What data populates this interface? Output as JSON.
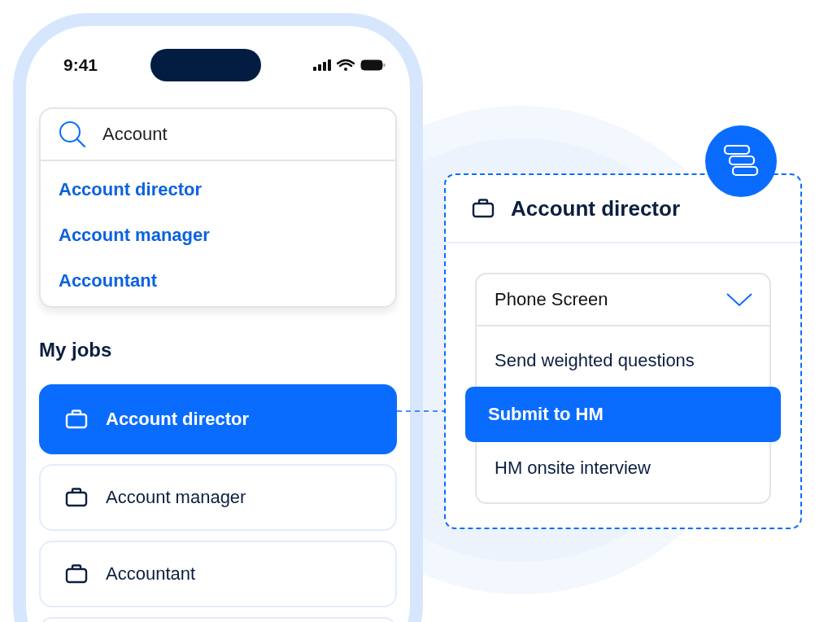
{
  "status_bar": {
    "time": "9:41"
  },
  "search": {
    "value": "Account"
  },
  "suggestions": [
    {
      "label": "Account director"
    },
    {
      "label": "Account manager"
    },
    {
      "label": "Accountant"
    }
  ],
  "my_jobs": {
    "title": "My jobs",
    "items": [
      {
        "label": "Account director",
        "selected": true
      },
      {
        "label": "Account manager",
        "selected": false
      },
      {
        "label": "Accountant",
        "selected": false
      }
    ]
  },
  "detail_card": {
    "title": "Account director",
    "stage_dropdown": {
      "value": "Phone Screen",
      "options": [
        {
          "label": "Send weighted questions",
          "selected": false
        },
        {
          "label": "Submit to HM",
          "selected": true
        },
        {
          "label": "HM onsite interview",
          "selected": false
        }
      ]
    }
  }
}
